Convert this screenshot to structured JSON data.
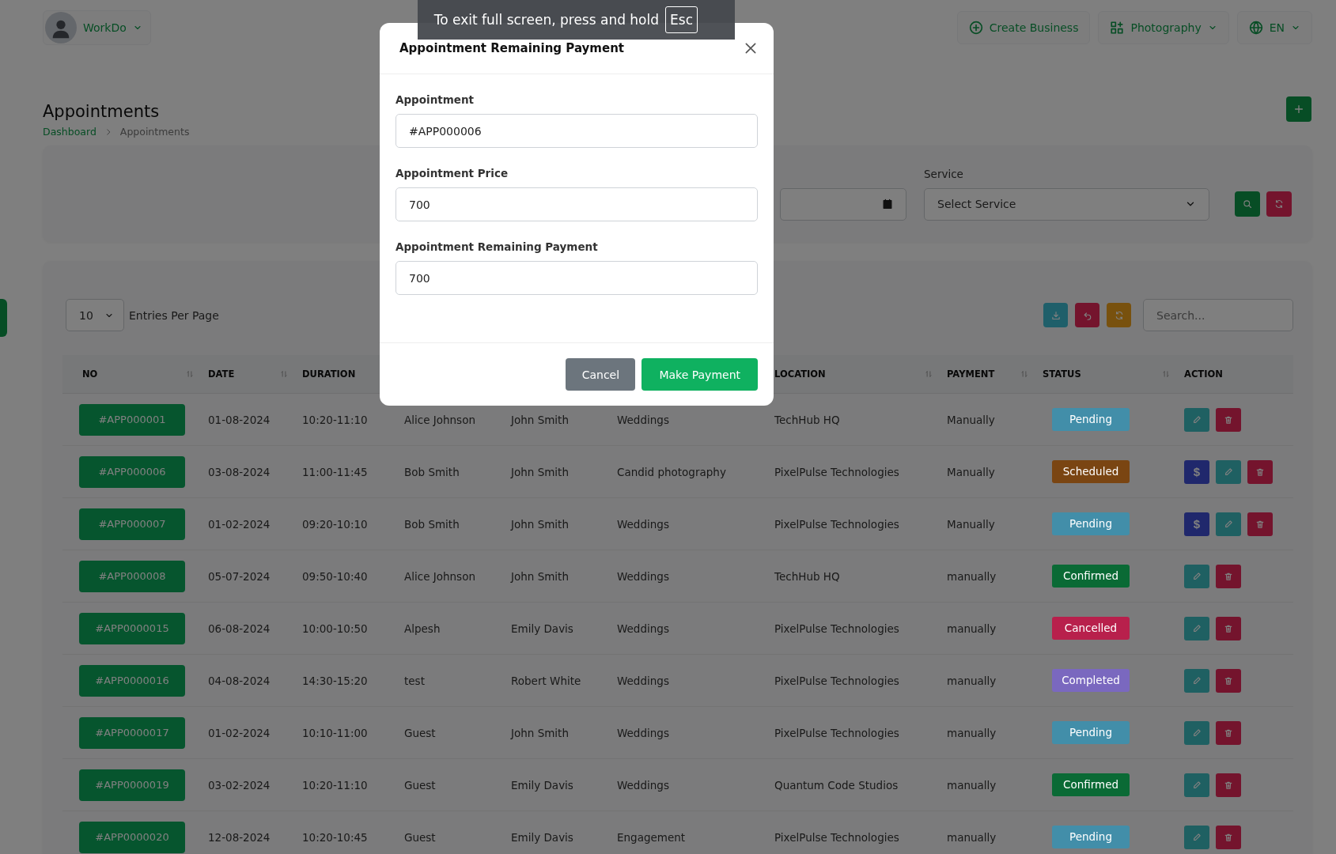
{
  "topbar": {
    "user": {
      "name": "WorkDo"
    },
    "create_business": "Create Business",
    "workspace": "Photography",
    "language": "EN"
  },
  "page": {
    "title": "Appointments",
    "breadcrumb": [
      "Dashboard",
      "Appointments"
    ]
  },
  "filter": {
    "service_label": "Service",
    "service_placeholder": "Select Service"
  },
  "table_tools": {
    "entries": "10",
    "entries_label": "Entries Per Page",
    "search_placeholder": "Search..."
  },
  "table": {
    "columns": [
      {
        "label": "NO",
        "sortable": true
      },
      {
        "label": "DATE",
        "sortable": true
      },
      {
        "label": "DURATION",
        "sortable": false
      },
      {},
      {},
      {},
      {
        "label": "LOCATION",
        "sortable": true
      },
      {
        "label": "PAYMENT",
        "sortable": true
      },
      {
        "label": "STATUS",
        "sortable": true
      },
      {
        "label": "ACTION",
        "sortable": false
      }
    ],
    "rows": [
      {
        "no": "#APP000001",
        "date": "01-08-2024",
        "duration": "10:20-11:10",
        "column_4": "Alice Johnson",
        "column_5": "John Smith",
        "column_6": "Weddings",
        "location": "TechHub HQ",
        "payment": "Manually",
        "status": {
          "label": "Pending",
          "color": "#428ea9"
        },
        "actions": [
          {
            "kind": "edit"
          },
          {
            "kind": "delete"
          }
        ]
      },
      {
        "no": "#APP000006",
        "date": "03-08-2024",
        "duration": "11:00-11:45",
        "column_4": "Bob Smith",
        "column_5": "John Smith",
        "column_6": "Candid photography",
        "location": "PixelPulse Technologies",
        "payment": "Manually",
        "status": {
          "label": "Scheduled",
          "color": "#7a4512"
        },
        "actions": [
          {
            "kind": "pay",
            "icon": "$"
          },
          {
            "kind": "edit"
          },
          {
            "kind": "delete"
          }
        ]
      },
      {
        "no": "#APP000007",
        "date": "01-02-2024",
        "duration": "09:20-10:10",
        "column_4": "Bob Smith",
        "column_5": "John Smith",
        "column_6": "Weddings",
        "location": "PixelPulse Technologies",
        "payment": "Manually",
        "status": {
          "label": "Pending",
          "color": "#428ea9"
        },
        "actions": [
          {
            "kind": "pay",
            "icon": "$"
          },
          {
            "kind": "edit"
          },
          {
            "kind": "delete"
          }
        ]
      },
      {
        "no": "#APP000008",
        "date": "05-07-2024",
        "duration": "09:50-10:40",
        "column_4": "Alice Johnson",
        "column_5": "John Smith",
        "column_6": "Weddings",
        "location": "TechHub HQ",
        "payment": "manually",
        "status": {
          "label": "Confirmed",
          "color": "#0a6a35"
        },
        "actions": [
          {
            "kind": "edit"
          },
          {
            "kind": "delete"
          }
        ]
      },
      {
        "no": "#APP0000015",
        "date": "06-08-2024",
        "duration": "10:00-10:50",
        "column_4": "Alpesh",
        "column_5": "Emily Davis",
        "column_6": "Weddings",
        "location": "PixelPulse Technologies",
        "payment": "manually",
        "status": {
          "label": "Cancelled",
          "color": "#b8204c"
        },
        "actions": [
          {
            "kind": "edit"
          },
          {
            "kind": "delete"
          }
        ]
      },
      {
        "no": "#APP0000016",
        "date": "04-08-2024",
        "duration": "14:30-15:20",
        "column_4": "test",
        "column_5": "Robert White",
        "column_6": "Weddings",
        "location": "PixelPulse Technologies",
        "payment": "manually",
        "status": {
          "label": "Completed",
          "color": "#7a68bf"
        },
        "actions": [
          {
            "kind": "edit"
          },
          {
            "kind": "delete"
          }
        ]
      },
      {
        "no": "#APP0000017",
        "date": "01-02-2024",
        "duration": "10:10-11:00",
        "column_4": "Guest",
        "column_5": "John Smith",
        "column_6": "Weddings",
        "location": "PixelPulse Technologies",
        "payment": "manually",
        "status": {
          "label": "Pending",
          "color": "#428ea9"
        },
        "actions": [
          {
            "kind": "edit"
          },
          {
            "kind": "delete"
          }
        ]
      },
      {
        "no": "#APP0000019",
        "date": "03-02-2024",
        "duration": "10:20-11:10",
        "column_4": "Guest",
        "column_5": "Emily Davis",
        "column_6": "Weddings",
        "location": "Quantum Code Studios",
        "payment": "manually",
        "status": {
          "label": "Confirmed",
          "color": "#0a6a35"
        },
        "actions": [
          {
            "kind": "edit"
          },
          {
            "kind": "delete"
          }
        ]
      },
      {
        "no": "#APP0000020",
        "date": "12-08-2024",
        "duration": "10:20-10:45",
        "column_4": "Guest",
        "column_5": "Emily Davis",
        "column_6": "Engagement",
        "location": "PixelPulse Technologies",
        "payment": "manually",
        "status": {
          "label": "Pending",
          "color": "#428ea9"
        },
        "actions": [
          {
            "kind": "edit"
          },
          {
            "kind": "delete"
          }
        ]
      }
    ]
  },
  "modal": {
    "title": "Appointment Remaining Payment",
    "fields": [
      {
        "label": "Appointment",
        "value": "#APP000006"
      },
      {
        "label": "Appointment Price",
        "value": "700"
      },
      {
        "label": "Appointment Remaining Payment",
        "value": "700"
      }
    ],
    "buttons": [
      {
        "kind": "secondary",
        "label": "Cancel"
      },
      {
        "kind": "primary",
        "label": "Make Payment"
      }
    ]
  },
  "fullscreen_notice": {
    "text": "To exit full screen, press and hold",
    "key": "Esc"
  }
}
